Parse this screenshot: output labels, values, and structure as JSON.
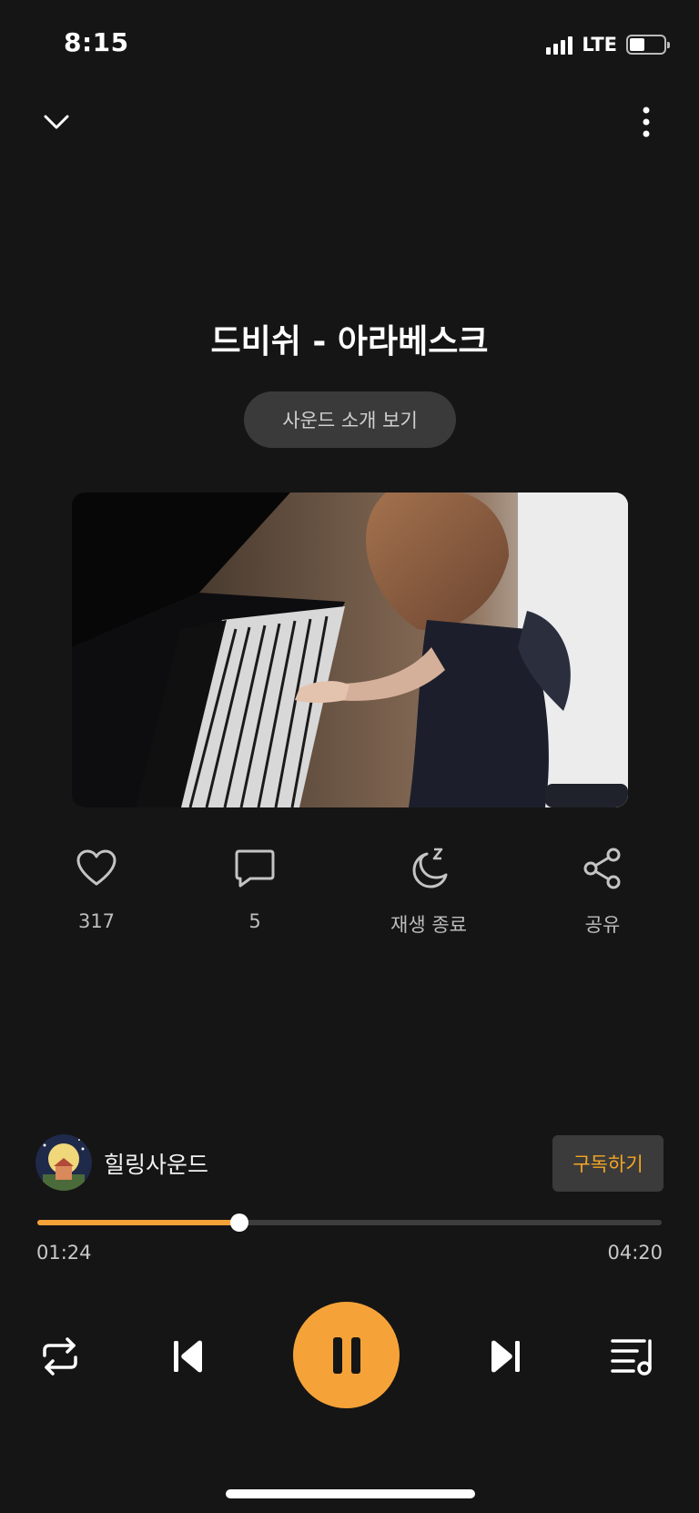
{
  "status_bar": {
    "time": "8:15",
    "network": "LTE"
  },
  "header": {
    "collapse_icon": "chevron-down-icon",
    "menu_icon": "more-vertical-icon"
  },
  "track": {
    "title": "드비쉬 - 아라베스크",
    "intro_button": "사운드 소개 보기",
    "artwork": "girl-playing-piano-video"
  },
  "actions": [
    {
      "icon": "heart-icon",
      "label": "317"
    },
    {
      "icon": "comment-icon",
      "label": "5"
    },
    {
      "icon": "sleep-timer-icon",
      "label": "재생 종료"
    },
    {
      "icon": "share-icon",
      "label": "공유"
    }
  ],
  "channel": {
    "name": "힐링사운드",
    "subscribe_label": "구독하기"
  },
  "progress": {
    "elapsed": "01:24",
    "duration": "04:20",
    "fraction": 0.323
  },
  "controls": {
    "repeat": "repeat-icon",
    "previous": "skip-back-icon",
    "play_pause": "pause-icon",
    "next": "skip-forward-icon",
    "playlist": "playlist-icon"
  },
  "colors": {
    "accent": "#f5a338",
    "background": "#151515",
    "button_bg": "#3a3a3a"
  }
}
